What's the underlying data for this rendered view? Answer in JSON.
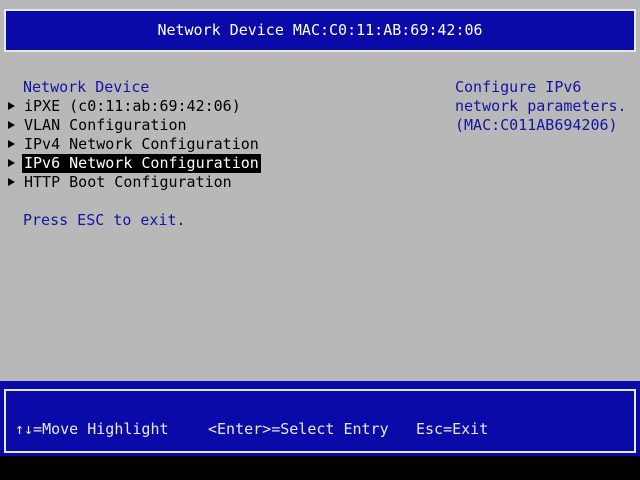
{
  "header": {
    "title": "Network Device MAC:C0:11:AB:69:42:06"
  },
  "main": {
    "section_title": "Network Device",
    "menu_items": [
      {
        "label": "iPXE (c0:11:ab:69:42:06)",
        "selected": false
      },
      {
        "label": "VLAN Configuration",
        "selected": false
      },
      {
        "label": "IPv4 Network Configuration",
        "selected": false
      },
      {
        "label": "IPv6 Network Configuration",
        "selected": true
      },
      {
        "label": "HTTP Boot Configuration",
        "selected": false
      }
    ],
    "hint": "Press ESC to exit."
  },
  "help_panel": {
    "line1": "Configure IPv6",
    "line2": "network parameters.",
    "line3": "(MAC:C011AB694206)"
  },
  "footer": {
    "move": "↑↓=Move Highlight",
    "select": "<Enter>=Select Entry",
    "exit": "Esc=Exit"
  },
  "colors": {
    "background": "#b8b8b8",
    "accent_blue": "#0a0aa8",
    "text_blue": "#1414a0",
    "highlight": "#000000"
  },
  "icons": {
    "menu_arrow": "triangle-right-icon"
  }
}
